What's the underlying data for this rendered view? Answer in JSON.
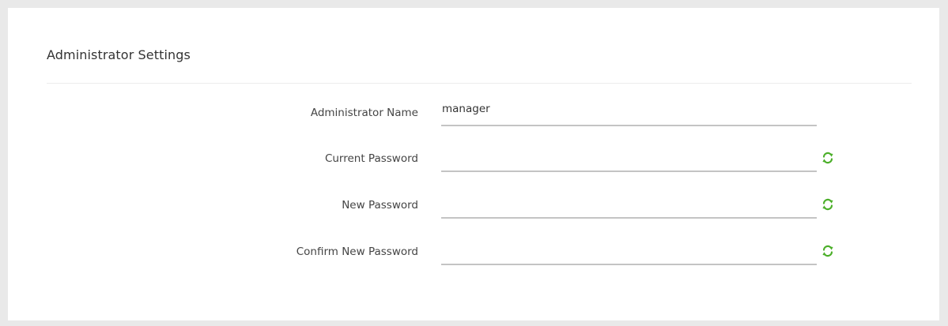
{
  "section": {
    "title": "Administrator Settings"
  },
  "fields": {
    "admin_name": {
      "label": "Administrator Name",
      "value": "manager"
    },
    "current_password": {
      "label": "Current Password",
      "value": "",
      "icon": "refresh-icon"
    },
    "new_password": {
      "label": "New Password",
      "value": "",
      "icon": "refresh-icon"
    },
    "confirm_password": {
      "label": "Confirm New Password",
      "value": "",
      "icon": "refresh-icon"
    }
  },
  "colors": {
    "accent_icon": "#4caf2a",
    "underline": "#c4c4c4",
    "background": "#e9e9e9"
  }
}
